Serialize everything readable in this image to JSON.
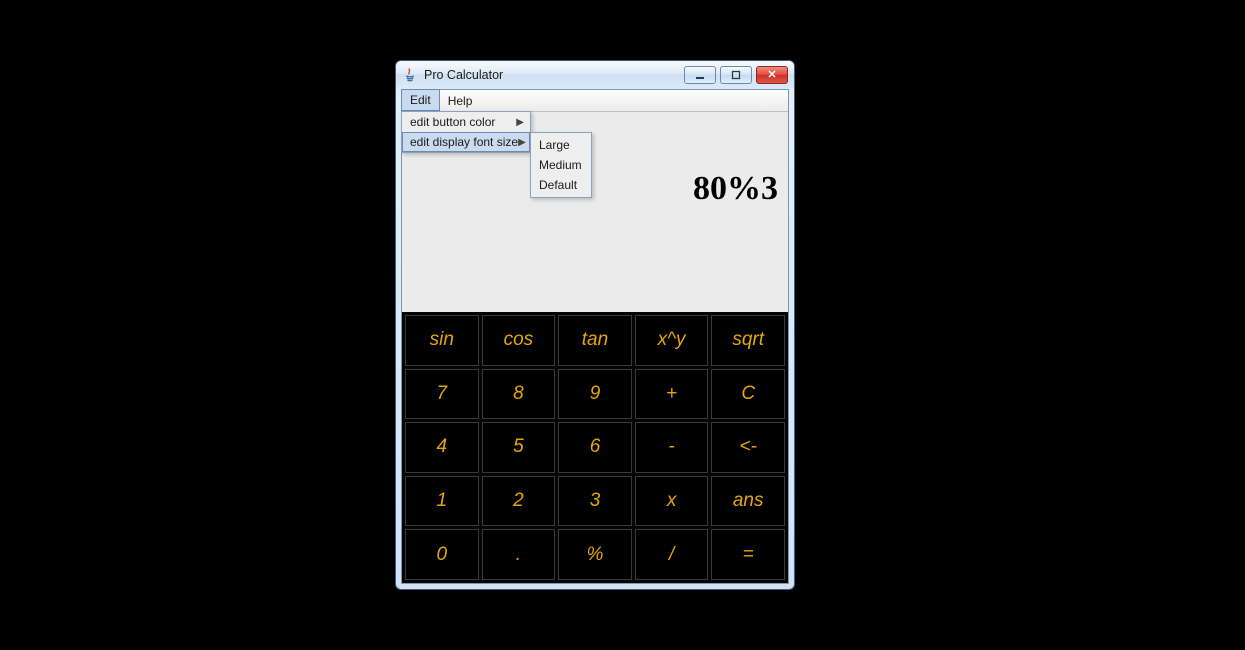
{
  "window": {
    "title": "Pro Calculator"
  },
  "menubar": {
    "edit": "Edit",
    "help": "Help"
  },
  "edit_menu": {
    "button_color": "edit button color",
    "font_size": "edit display font size"
  },
  "font_size_submenu": {
    "large": "Large",
    "medium": "Medium",
    "default": "Default"
  },
  "display": {
    "value": "80%3"
  },
  "keys": {
    "r0": [
      "sin",
      "cos",
      "tan",
      "x^y",
      "sqrt"
    ],
    "r1": [
      "7",
      "8",
      "9",
      "+",
      "C"
    ],
    "r2": [
      "4",
      "5",
      "6",
      "-",
      "<-"
    ],
    "r3": [
      "1",
      "2",
      "3",
      "x",
      "ans"
    ],
    "r4": [
      "0",
      ".",
      "%",
      "/",
      "="
    ]
  },
  "colors": {
    "key_fg": "#e6a60b",
    "key_bg": "#000000"
  }
}
